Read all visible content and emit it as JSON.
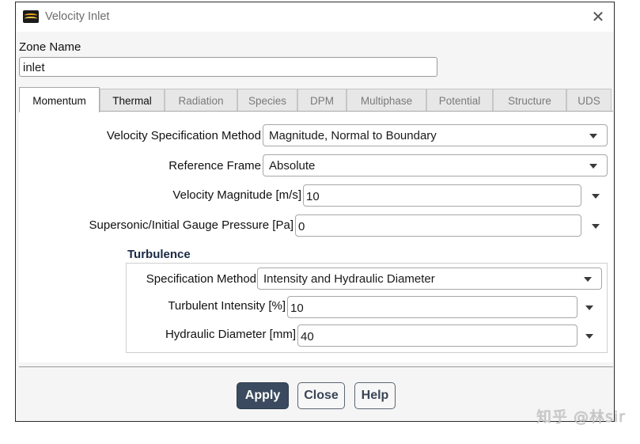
{
  "window": {
    "title": "Velocity Inlet",
    "close_glyph": "✕"
  },
  "zone": {
    "label": "Zone Name",
    "value": "inlet"
  },
  "tabs": [
    {
      "label": "Momentum",
      "active": true,
      "enabled": true
    },
    {
      "label": "Thermal",
      "active": false,
      "enabled": true
    },
    {
      "label": "Radiation",
      "active": false,
      "enabled": false
    },
    {
      "label": "Species",
      "active": false,
      "enabled": false
    },
    {
      "label": "DPM",
      "active": false,
      "enabled": false
    },
    {
      "label": "Multiphase",
      "active": false,
      "enabled": false
    },
    {
      "label": "Potential",
      "active": false,
      "enabled": false
    },
    {
      "label": "Structure",
      "active": false,
      "enabled": false
    },
    {
      "label": "UDS",
      "active": false,
      "enabled": false
    }
  ],
  "momentum": {
    "velocity_spec": {
      "label": "Velocity Specification Method",
      "value": "Magnitude, Normal to Boundary"
    },
    "reference_frame": {
      "label": "Reference Frame",
      "value": "Absolute"
    },
    "velocity_magnitude": {
      "label": "Velocity Magnitude [m/s]",
      "value": "10"
    },
    "gauge_pressure": {
      "label": "Supersonic/Initial Gauge Pressure [Pa]",
      "value": "0"
    }
  },
  "turbulence": {
    "title": "Turbulence",
    "spec_method": {
      "label": "Specification Method",
      "value": "Intensity and Hydraulic Diameter"
    },
    "intensity": {
      "label": "Turbulent Intensity [%]",
      "value": "10"
    },
    "hydraulic_diameter": {
      "label": "Hydraulic Diameter [mm]",
      "value": "40"
    }
  },
  "buttons": {
    "apply": "Apply",
    "close": "Close",
    "help": "Help"
  },
  "watermark": "知乎 @林sir",
  "colors": {
    "primary_button": "#3b4a5e",
    "group_title": "#1a2a44",
    "app_icon": "#e8a21a"
  },
  "icons": {
    "app": "ansys-fluent-icon",
    "close": "close-icon",
    "dropdown": "chevron-down-icon"
  }
}
